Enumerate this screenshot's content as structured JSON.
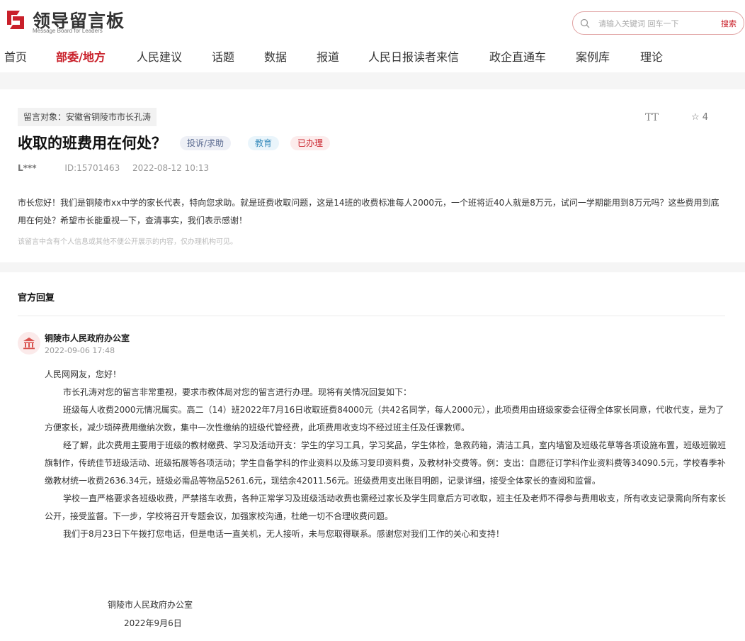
{
  "header": {
    "logo_title": "领导留言板",
    "logo_subtitle": "Message Board for Leaders",
    "search_placeholder": "请输入关键词 回车一下",
    "search_button": "搜索",
    "brand_color": "#c9202a"
  },
  "nav": {
    "items": [
      "首页",
      "部委/地方",
      "人民建议",
      "话题",
      "数据",
      "报道",
      "人民日报读者来信",
      "政企直通车",
      "案例库",
      "理论"
    ],
    "active_index": 1
  },
  "message": {
    "target": "留言对象：安徽省铜陵市市长孔涛",
    "title": "收取的班费用在何处？",
    "tags": [
      "投诉/求助",
      "教育",
      "已办理"
    ],
    "font_toggle": "TT",
    "star_count": "4",
    "author": "L***",
    "id": "ID:15701463",
    "time": "2022-08-12 10:13",
    "body": "市长您好！我们是铜陵市xx中学的家长代表，特向您求助。就是班费收取问题，这是14班的收费标准每人2000元，一个班将近40人就是8万元，试问一学期能用到8万元吗？这些费用到底用在何处？希望市长能重视一下，查清事实，我们表示感谢！",
    "notice": "该留言中含有个人信息或其他不便公开展示的内容，仅办理机构可见。"
  },
  "reply": {
    "heading": "官方回复",
    "org": "铜陵市人民政府办公室",
    "time": "2022-09-06 17:48",
    "greeting": "人民网网友，您好！",
    "paragraphs": [
      "市长孔涛对您的留言非常重视，要求市教体局对您的留言进行办理。现将有关情况回复如下：",
      "班级每人收费2000元情况属实。高二（14）班2022年7月16日收取班费84000元（共42名同学，每人2000元），此项费用由班级家委会征得全体家长同意，代收代支，是为了方便家长，减少琐碎费用缴纳次数，集中一次性缴纳的班级代管经费，此项费用收支均不经过班主任及任课教师。",
      "经了解，此次费用主要用于班级的教材缴费、学习及活动开支：学生的学习工具，学习奖品，学生体检，急救药箱，清洁工具，室内墙窗及班级花草等各项设施布置，班级班徽班旗制作，传统佳节班级活动、班级拓展等各项活动；学生自备学科的作业资料以及练习复印资料费，及教材补交费等。例：支出：自愿征订学科作业资料费等34090.5元，学校春季补缴教材统一收费2636.34元，班级必需品等物品5261.6元，现结余42011.56元。班级费用支出账目明朗，记录详细，接受全体家长的查阅和监督。",
      "学校一直严格要求各班级收费，严禁搭车收费，各种正常学习及班级活动收费也需经过家长及学生同意后方可收取，班主任及老师不得参与费用收支，所有收支记录需向所有家长公开，接受监督。下一步，学校将召开专题会议，加强家校沟通，杜绝一切不合理收费问题。",
      "我们于8月23日下午拨打您电话，但是电话一直关机，无人接听，未与您取得联系。感谢您对我们工作的关心和支持！"
    ],
    "signature": "铜陵市人民政府办公室",
    "signature_date": "2022年9月6日"
  }
}
